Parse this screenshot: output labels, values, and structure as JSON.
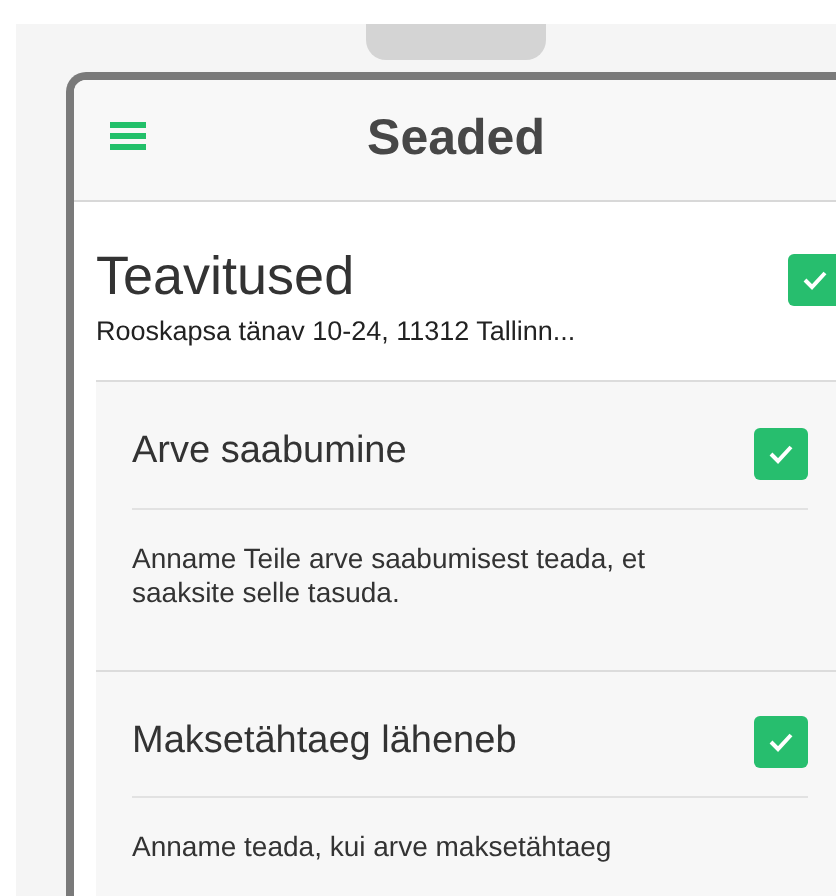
{
  "header": {
    "title": "Seaded"
  },
  "section": {
    "title": "Teavitused",
    "subtitle": "Rooskapsa tänav 10-24, 11312 Tallinn...",
    "checked": true
  },
  "notifications": [
    {
      "title": "Arve saabumine",
      "checked": true,
      "description": "Anname Teile arve saabumisest teada, et saaksite selle tasuda."
    },
    {
      "title": "Maksetähtaeg läheneb",
      "checked": true,
      "description": "Anname teada, kui arve maksetähtaeg"
    }
  ]
}
